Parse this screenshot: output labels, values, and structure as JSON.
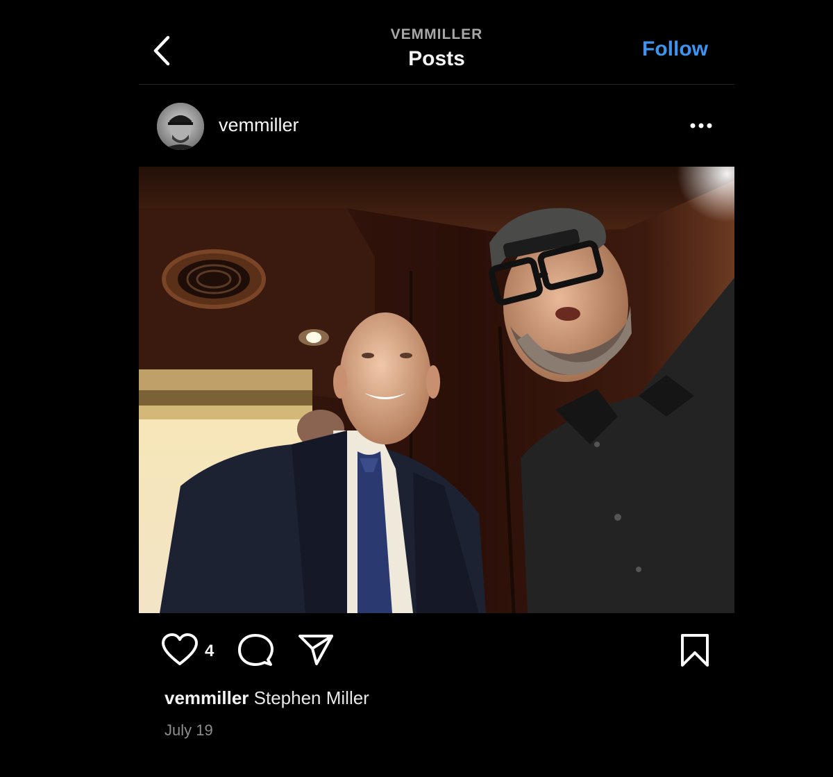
{
  "header": {
    "subtitle": "VEMMILLER",
    "title": "Posts",
    "follow_label": "Follow"
  },
  "post": {
    "username": "vemmiller",
    "like_count": "4",
    "caption_user": "vemmiller",
    "caption_text": "Stephen Miller",
    "date": "July 19"
  },
  "icons": {
    "back": "chevron-left-icon",
    "more": "more-horizontal-icon",
    "like": "heart-icon",
    "comment": "comment-icon",
    "share": "send-icon",
    "save": "bookmark-icon"
  },
  "colors": {
    "background": "#000000",
    "accent": "#3d94f0",
    "muted": "#8e8e8e"
  }
}
